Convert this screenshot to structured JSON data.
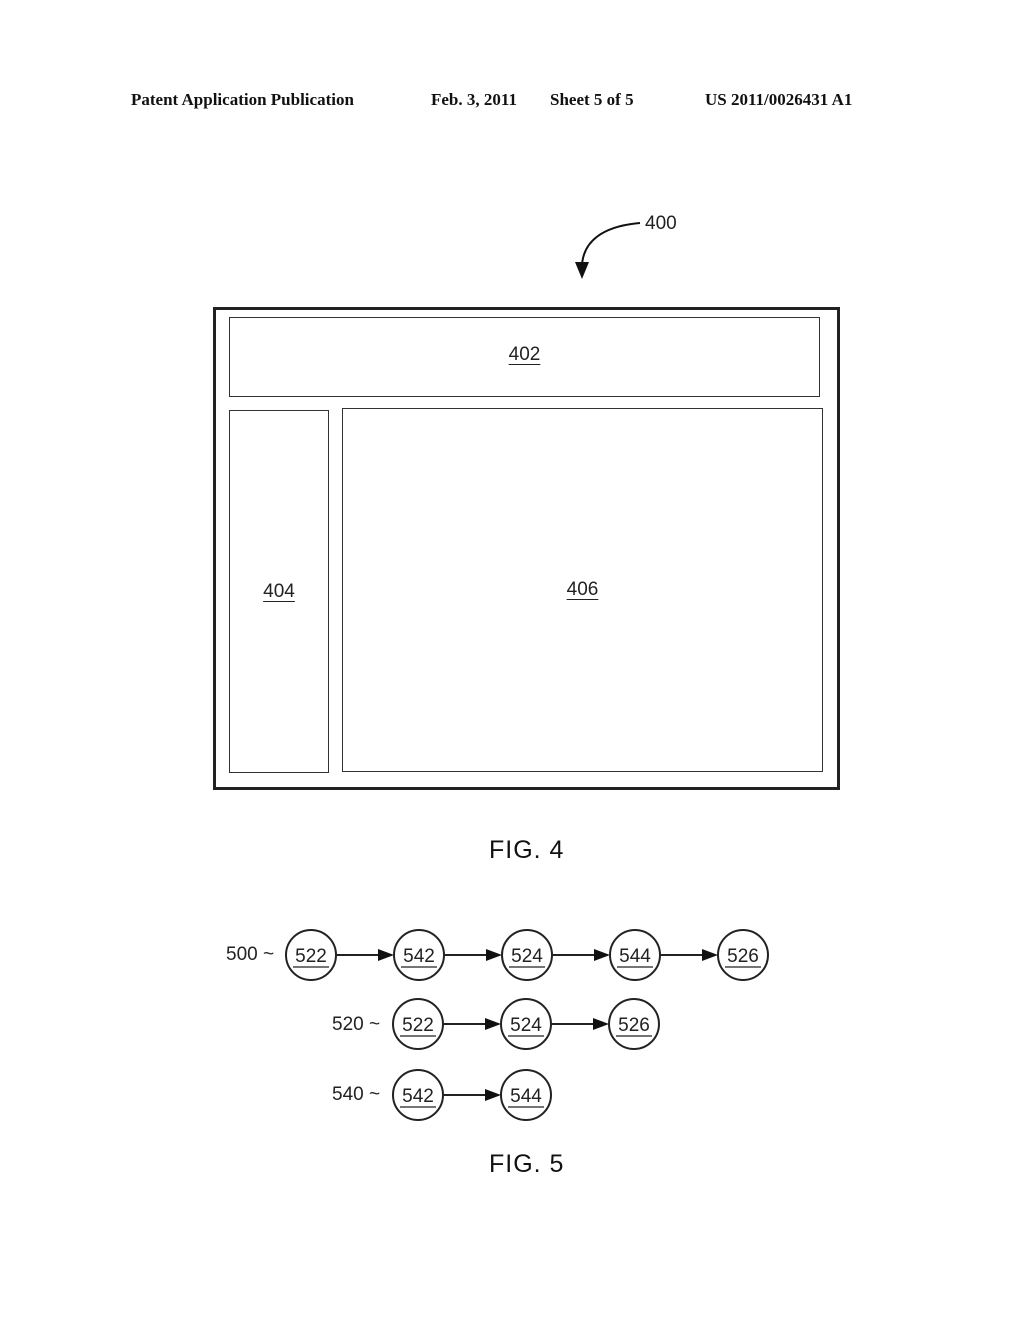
{
  "header": {
    "publication": "Patent Application Publication",
    "date": "Feb. 3, 2011",
    "sheet": "Sheet 5 of 5",
    "number": "US 2011/0026431 A1"
  },
  "fig4": {
    "caption": "FIG. 4",
    "ref_label": "400",
    "regions": {
      "top": "402",
      "left": "404",
      "main": "406"
    }
  },
  "fig5": {
    "caption": "FIG. 5",
    "sequences": [
      {
        "label": "500 ~",
        "nodes": [
          "522",
          "542",
          "524",
          "544",
          "526"
        ]
      },
      {
        "label": "520 ~",
        "nodes": [
          "522",
          "524",
          "526"
        ]
      },
      {
        "label": "540 ~",
        "nodes": [
          "542",
          "544"
        ]
      }
    ]
  }
}
